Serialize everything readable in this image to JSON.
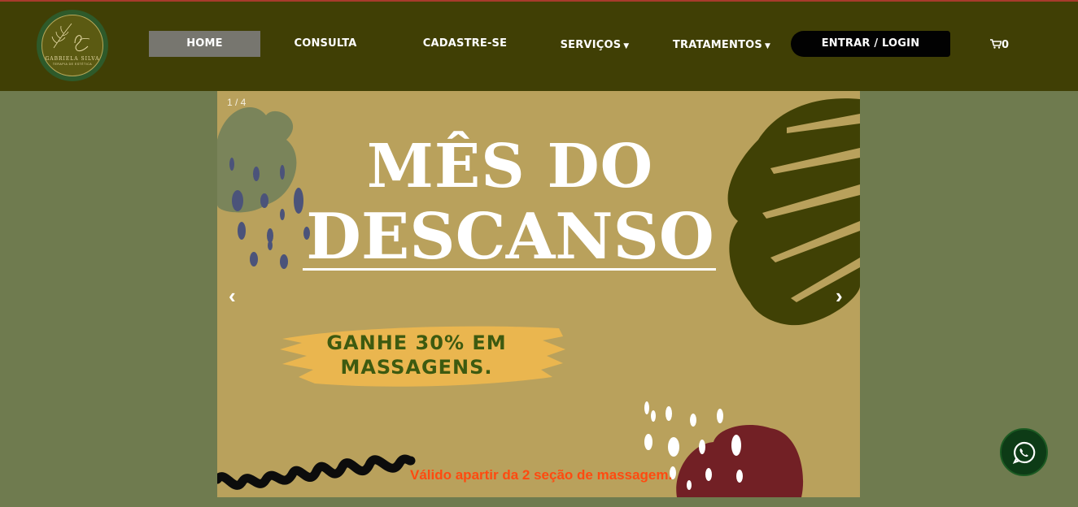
{
  "logo": {
    "name": "GABRIELA SILVA",
    "subtitle": "TERAPIA DE ESTÉTICA"
  },
  "nav": {
    "home": "HOME",
    "consulta": "CONSULTA",
    "cadastre": "CADASTRE-SE",
    "servicos": "SERVIÇOS",
    "tratamentos": "TRATAMENTOS",
    "login": "ENTRAR / LOGIN",
    "cart_count": "0"
  },
  "slider": {
    "counter": "1 / 4",
    "headline_line1": "MÊS DO",
    "headline_line2": "DESCANSO",
    "promo_line1": "GANHE 30% EM",
    "promo_line2": "MASSAGENS.",
    "valid_note": "Válido apartir da 2 seção de massagem.",
    "prev": "‹",
    "next": "›"
  },
  "icons": {
    "caret": "caret-down-icon",
    "cart": "shopping-cart-icon",
    "whatsapp": "whatsapp-icon"
  },
  "colors": {
    "navbar": "#403f05",
    "page_background": "#6f7b4f",
    "slide_background": "#b9a15c",
    "home_active": "#77766f",
    "login_button": "#020202",
    "promo_text": "#3d5a10",
    "valid_text": "#ff4a10",
    "whatsapp_button": "#0d3b16"
  }
}
